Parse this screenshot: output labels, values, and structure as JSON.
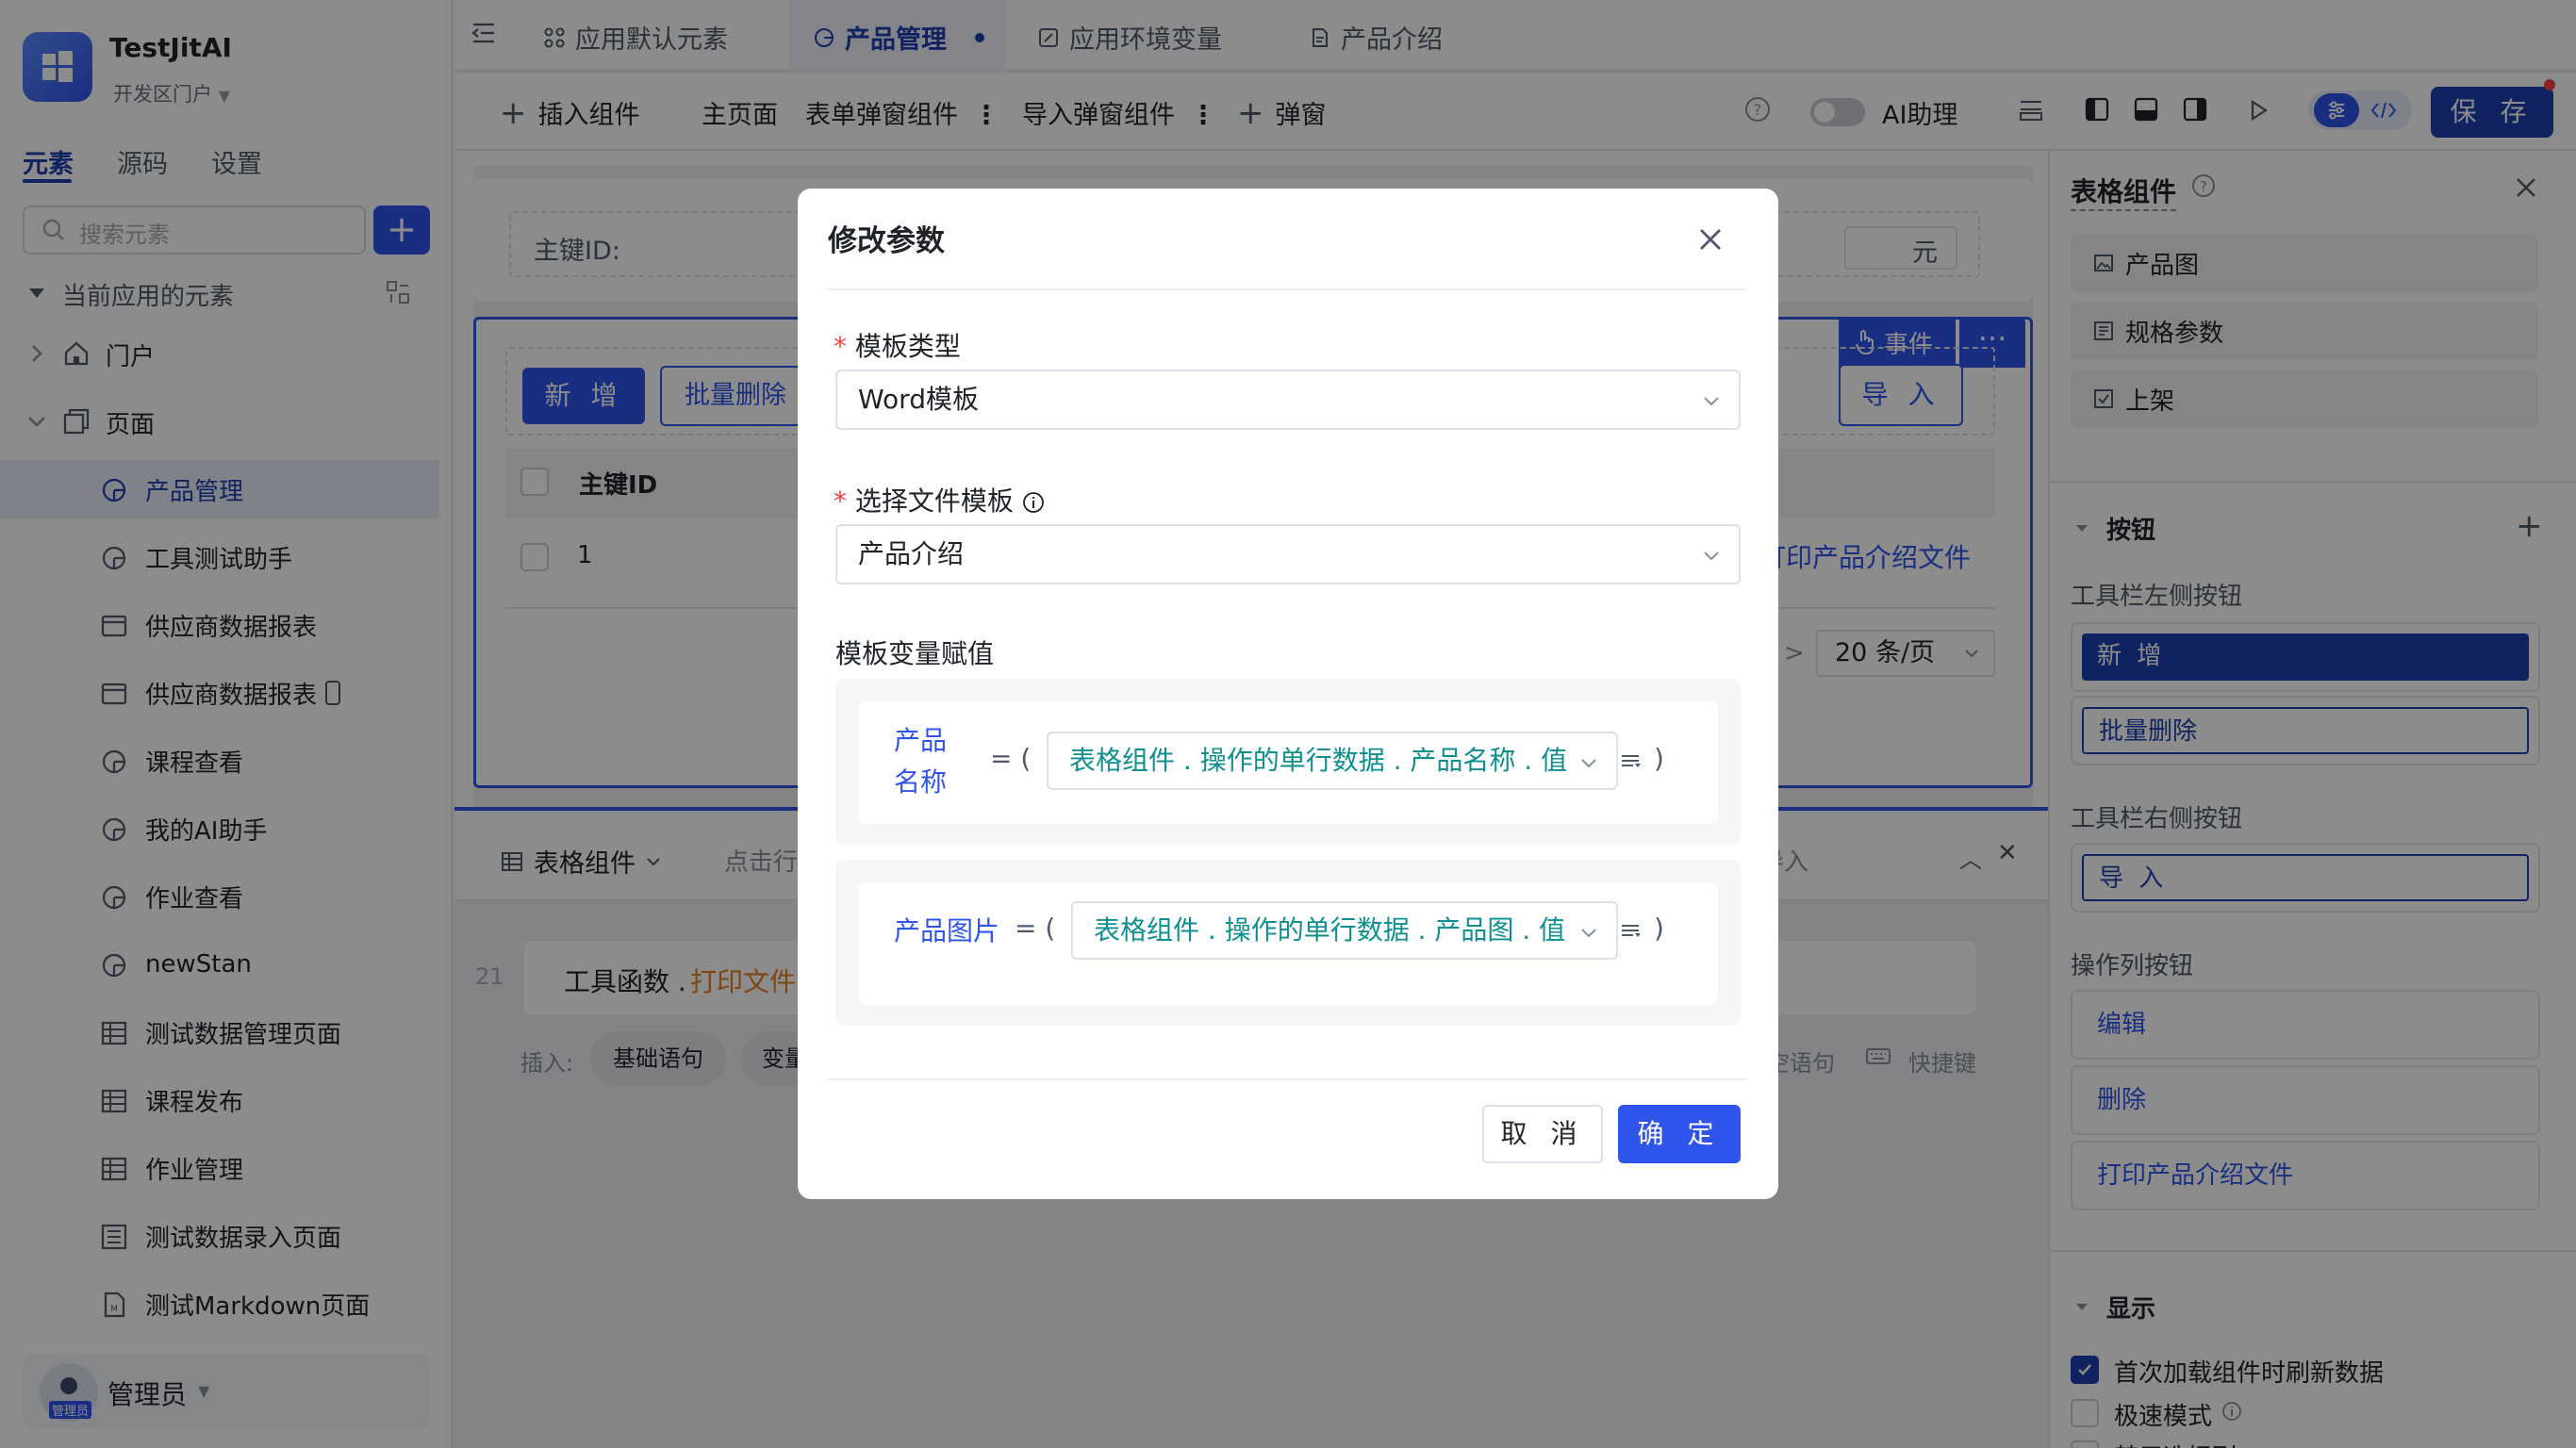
{
  "app": {
    "name": "TestJitAI",
    "portal": "开发区门户"
  },
  "sidebar": {
    "tabs": [
      "元素",
      "源码",
      "设置"
    ],
    "search_placeholder": "搜索元素",
    "section_title": "当前应用的元素",
    "groups": [
      "门户",
      "页面"
    ],
    "items": [
      {
        "label": "产品管理",
        "icon": "page-icon",
        "active": true
      },
      {
        "label": "工具测试助手",
        "icon": "page-icon"
      },
      {
        "label": "供应商数据报表",
        "icon": "report-icon"
      },
      {
        "label": "供应商数据报表",
        "icon": "report-icon"
      },
      {
        "label": "课程查看",
        "icon": "page-icon"
      },
      {
        "label": "我的AI助手",
        "icon": "page-icon"
      },
      {
        "label": "作业查看",
        "icon": "page-icon"
      },
      {
        "label": "newStan",
        "icon": "page-icon"
      },
      {
        "label": "测试数据管理页面",
        "icon": "table-icon"
      },
      {
        "label": "课程发布",
        "icon": "table-icon"
      },
      {
        "label": "作业管理",
        "icon": "table-icon"
      },
      {
        "label": "测试数据录入页面",
        "icon": "form-icon"
      },
      {
        "label": "测试Markdown页面",
        "icon": "markdown-icon"
      }
    ],
    "user": {
      "name": "管理员",
      "avatar_caption": "管理员"
    }
  },
  "top_tabs": [
    "应用默认元素",
    "产品管理",
    "应用环境变量",
    "产品介绍"
  ],
  "toolbar": {
    "insert_component": "插入组件",
    "main_page": "主页面",
    "form_popup": "表单弹窗组件",
    "import_popup": "导入弹窗组件",
    "popup": "弹窗",
    "ai_assistant": "AI助理",
    "save": "保 存"
  },
  "canvas": {
    "pk_label": "主键ID:",
    "unit": "元",
    "event_label": "事件",
    "add_btn": "新 增",
    "batch_delete": "批量删除",
    "import_btn": "导 入",
    "col_header": "主键ID",
    "row_id": "1",
    "print_link": "打印产品介绍文件",
    "page_size": "20 条/页",
    "bottom_tab": "表格组件",
    "bottom_hint": "点击行",
    "bottom_right": "导入",
    "line_no": "21",
    "code_prefix": "工具函数 .",
    "code_fn": "打印文件",
    "insert_label": "插入:",
    "insert_basic": "基础语句",
    "insert_var": "变量",
    "empty_stmt": "空语句",
    "shortcut": "快捷键"
  },
  "right_panel": {
    "title": "表格组件",
    "fields": [
      "产品图",
      "规格参数",
      "上架"
    ],
    "buttons_section": "按钮",
    "left_toolbar_label": "工具栏左侧按钮",
    "left_buttons": [
      "新 增",
      "批量删除"
    ],
    "right_toolbar_label": "工具栏右侧按钮",
    "right_buttons": [
      "导 入"
    ],
    "op_label": "操作列按钮",
    "op_buttons": [
      "编辑",
      "删除",
      "打印产品介绍文件"
    ],
    "display_section": "显示",
    "display_options": [
      {
        "label": "首次加载组件时刷新数据",
        "checked": true
      },
      {
        "label": "极速模式",
        "checked": false
      },
      {
        "label": "禁用选择列",
        "checked": false
      }
    ]
  },
  "modal": {
    "title": "修改参数",
    "template_type_label": "模板类型",
    "template_type_value": "Word模板",
    "file_template_label": "选择文件模板",
    "file_template_value": "产品介绍",
    "vars_label": "模板变量赋值",
    "vars": [
      {
        "name": "产品名称",
        "expr": "表格组件 . 操作的单行数据 . 产品名称 . 值"
      },
      {
        "name": "产品图片",
        "expr": "表格组件 . 操作的单行数据 . 产品图 . 值"
      }
    ],
    "cancel": "取 消",
    "ok": "确 定"
  }
}
